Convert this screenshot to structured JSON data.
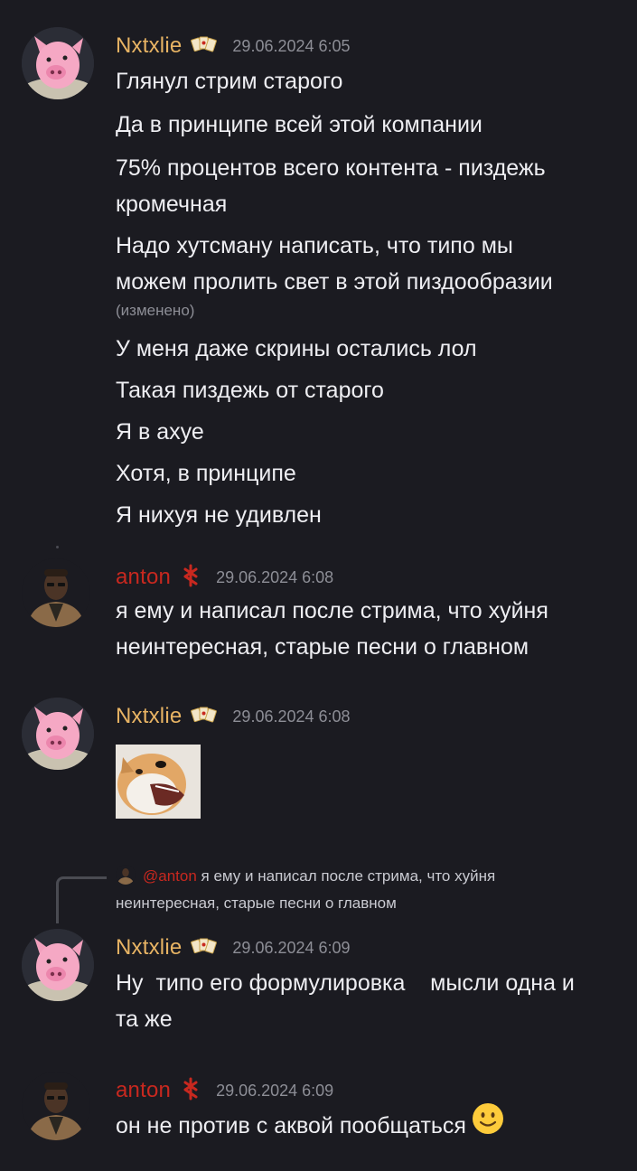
{
  "messages": [
    {
      "author": "Nxtxlie",
      "time": "29.06.2024 6:05",
      "lines": [
        "Глянул стрим старого",
        "Да в принципе всей этой компании",
        "75% процентов всего контента - пиздежь",
        "кромечная",
        "Надо  хутсману написать, что  типо мы",
        "можем  пролить свет в этой пиздообразии",
        "У меня даже скрины остались лол",
        "Такая пиздежь от старого",
        "Я в ахуе",
        "Хотя, в принципе",
        "Я нихуя не удивлен"
      ],
      "edited_label": "(изменено)"
    },
    {
      "author": "anton",
      "time": "29.06.2024 6:08",
      "lines": [
        "я ему и написал после стрима, что хуйня",
        "неинтересная, старые песни о главном"
      ]
    },
    {
      "author": "Nxtxlie",
      "time": "29.06.2024 6:08",
      "attachment": "dog-image"
    },
    {
      "author": "Nxtxlie",
      "time": "29.06.2024 6:09",
      "reply": {
        "mention": "@anton",
        "line1": "я ему и написал после стрима, что хуйня",
        "line2": "неинтересная, старые песни о главном"
      },
      "lines": [
        "Ну  типо его формулировка    мысли одна и",
        "та же"
      ]
    },
    {
      "author": "anton",
      "time": "29.06.2024 6:09",
      "lines": [
        "он не против с аквой пообщаться"
      ],
      "emoji": "slightly-smiling-face"
    }
  ],
  "colors": {
    "background": "#1b1b21",
    "nxtxlie_name": "#e8b464",
    "anton_name": "#c8281f",
    "timestamp": "#8d8e96",
    "text": "#eeeef2"
  }
}
